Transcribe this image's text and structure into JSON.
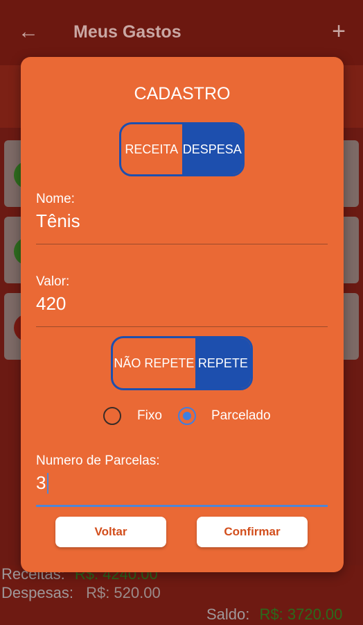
{
  "appbar": {
    "title": "Meus Gastos",
    "back_icon": "arrow-left-icon",
    "add_icon": "plus-icon"
  },
  "summary": {
    "receitas_label": "Receitas:",
    "receitas_value": "R$: 4240.00",
    "despesas_label": "Despesas:",
    "despesas_value": "R$: 520.00",
    "saldo_label": "Saldo:",
    "saldo_value": "R$: 3720.00"
  },
  "dialog": {
    "title": "CADASTRO",
    "type_toggle": {
      "options": [
        "RECEITA",
        "DESPESA"
      ],
      "selected": "DESPESA"
    },
    "nome": {
      "label": "Nome:",
      "value": "Tênis"
    },
    "valor": {
      "label": "Valor:",
      "value": "420"
    },
    "repeat_toggle": {
      "options": [
        "NÃO REPETE",
        "REPETE"
      ],
      "selected": "REPETE"
    },
    "repeat_mode": {
      "options": [
        "Fixo",
        "Parcelado"
      ],
      "selected": "Parcelado"
    },
    "parcelas": {
      "label": "Numero de Parcelas:",
      "value": "3"
    },
    "buttons": {
      "back": "Voltar",
      "confirm": "Confirmar"
    }
  },
  "colors": {
    "dialog_bg": "#ea6935",
    "toggle_active": "#1d4fae",
    "focus_accent": "#4f86d6",
    "button_text": "#d24e1c"
  }
}
